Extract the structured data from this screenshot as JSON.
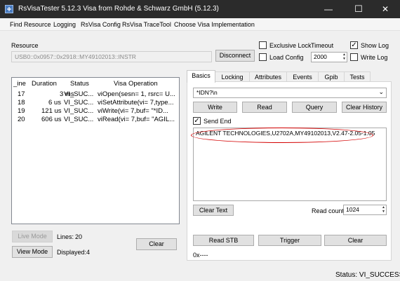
{
  "window": {
    "title": "RsVisaTester 5.12.3 Visa from Rohde & Schwarz GmbH (5.12.3)",
    "controls": {
      "minimize": "—",
      "maximize": "☐",
      "close": "✕"
    }
  },
  "menu": {
    "items": [
      "Find Resource",
      "Logging",
      "RsVisa Config",
      "RsVisa TraceTool",
      "Choose Visa Implementation"
    ]
  },
  "resource": {
    "label": "Resource",
    "value": "USB0::0x0957::0x2918::MY49102013::INSTR",
    "disconnect_label": "Disconnect"
  },
  "options": {
    "exclusive_lock": {
      "label": "Exclusive Lock",
      "checked": false
    },
    "load_config": {
      "label": "Load Config",
      "checked": false
    },
    "timeout_label": "Timeout",
    "timeout_value": "2000",
    "show_log": {
      "label": "Show Log",
      "checked": true
    },
    "write_log": {
      "label": "Write Log",
      "checked": false
    }
  },
  "log_table": {
    "columns": [
      "_ine",
      "Duration",
      "Status",
      "Visa Operation"
    ],
    "rows": [
      {
        "line": "17",
        "duration": "3 ms",
        "status": "VI_SUC...",
        "operation": "viOpen(sesn= 1, rsrc= U..."
      },
      {
        "line": "18",
        "duration": "6 us",
        "status": "VI_SUC...",
        "operation": "viSetAttribute(vi= 7,type..."
      },
      {
        "line": "19",
        "duration": "121 us",
        "status": "VI_SUC...",
        "operation": "viWrite(vi= 7,buf= \"*ID..."
      },
      {
        "line": "20",
        "duration": "606 us",
        "status": "VI_SUC...",
        "operation": "viRead(vi= 7,buf= \"AGIL..."
      }
    ]
  },
  "left_bottom": {
    "live_mode_label": "Live Mode",
    "lines_label": "Lines:",
    "lines_value": "20",
    "view_mode_label": "View Mode",
    "displayed_label": "Displayed:",
    "displayed_value": "4",
    "clear_label": "Clear"
  },
  "tabs": [
    "Basics",
    "Locking",
    "Attributes",
    "Events",
    "Gpib",
    "Tests"
  ],
  "basics": {
    "command_value": "*IDN?\\n",
    "write_label": "Write",
    "read_label": "Read",
    "query_label": "Query",
    "clear_history_label": "Clear History",
    "send_end": {
      "label": "Send End",
      "checked": true
    },
    "response": "AGILENT TECHNOLOGIES,U2702A,MY49102013,V2.47-2.05-1.05",
    "clear_text_label": "Clear Text",
    "read_count_label": "Read count",
    "read_count_value": "1024",
    "read_stb_label": "Read STB",
    "trigger_label": "Trigger",
    "clear_label": "Clear",
    "stb_value": "0x----"
  },
  "status": {
    "text": "Status: VI_SUCCESS"
  },
  "colors": {
    "highlight": "#d40000",
    "titlebar": "#2b2b2b"
  },
  "icons": {
    "dropdown": "chevron-down-icon",
    "spin": "spin-arrows-icon",
    "app": "app-icon",
    "check": "checkmark-icon"
  }
}
